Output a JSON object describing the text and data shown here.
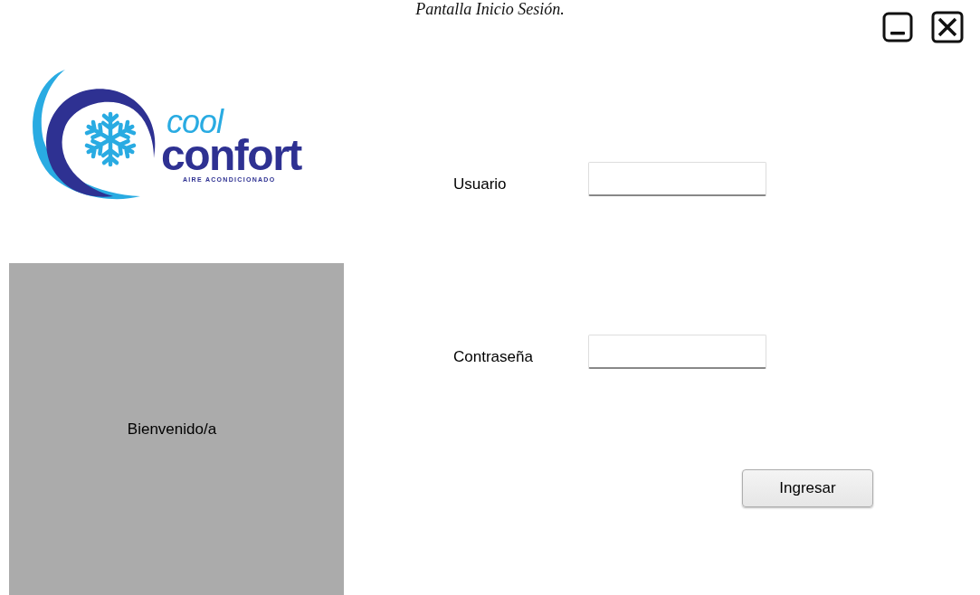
{
  "caption": "Pantalla Inicio Sesión.",
  "window_controls": [
    {
      "kind": "minimize"
    },
    {
      "kind": "close"
    }
  ],
  "logo": {
    "line_1": "cool",
    "line_2": "confort",
    "tagline": "AIRE ACONDICIONADO"
  },
  "welcome_panel": {
    "text": "Bienvenido/a"
  },
  "form": {
    "fields": [
      {
        "label": "Usuario"
      },
      {
        "label": "Contraseña"
      }
    ],
    "submit": "Ingresar"
  }
}
